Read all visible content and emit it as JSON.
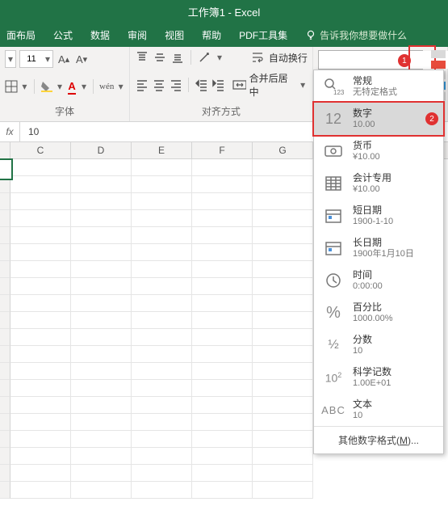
{
  "title": "工作簿1  -  Excel",
  "tabs": [
    "面布局",
    "公式",
    "数据",
    "审阅",
    "视图",
    "帮助",
    "PDF工具集"
  ],
  "tell_me": "告诉我你想要做什么",
  "ribbon": {
    "font_size": "11",
    "font_group": "字体",
    "align_group": "对齐方式",
    "wrap": "自动换行",
    "merge": "合并后居中"
  },
  "number_format_input": "",
  "formula": {
    "fx": "fx",
    "value": "10"
  },
  "columns": [
    "",
    "C",
    "D",
    "E",
    "F",
    "G"
  ],
  "callouts": {
    "one": "1",
    "two": "2"
  },
  "formats": [
    {
      "icon": "general",
      "title": "常规",
      "sub": "无特定格式"
    },
    {
      "icon": "number",
      "title": "数字",
      "sub": "10.00",
      "selected": true
    },
    {
      "icon": "currency",
      "title": "货币",
      "sub": "¥10.00"
    },
    {
      "icon": "accounting",
      "title": "会计专用",
      "sub": "¥10.00"
    },
    {
      "icon": "shortdate",
      "title": "短日期",
      "sub": "1900-1-10"
    },
    {
      "icon": "longdate",
      "title": "长日期",
      "sub": "1900年1月10日"
    },
    {
      "icon": "time",
      "title": "时间",
      "sub": "0:00:00"
    },
    {
      "icon": "percent",
      "title": "百分比",
      "sub": "1000.00%"
    },
    {
      "icon": "fraction",
      "title": "分数",
      "sub": "10"
    },
    {
      "icon": "scientific",
      "title": "科学记数",
      "sub": "1.00E+01"
    },
    {
      "icon": "text",
      "title": "文本",
      "sub": "10"
    }
  ],
  "more_formats": {
    "pre": "其他数字格式(",
    "key": "M",
    "post": ")..."
  }
}
